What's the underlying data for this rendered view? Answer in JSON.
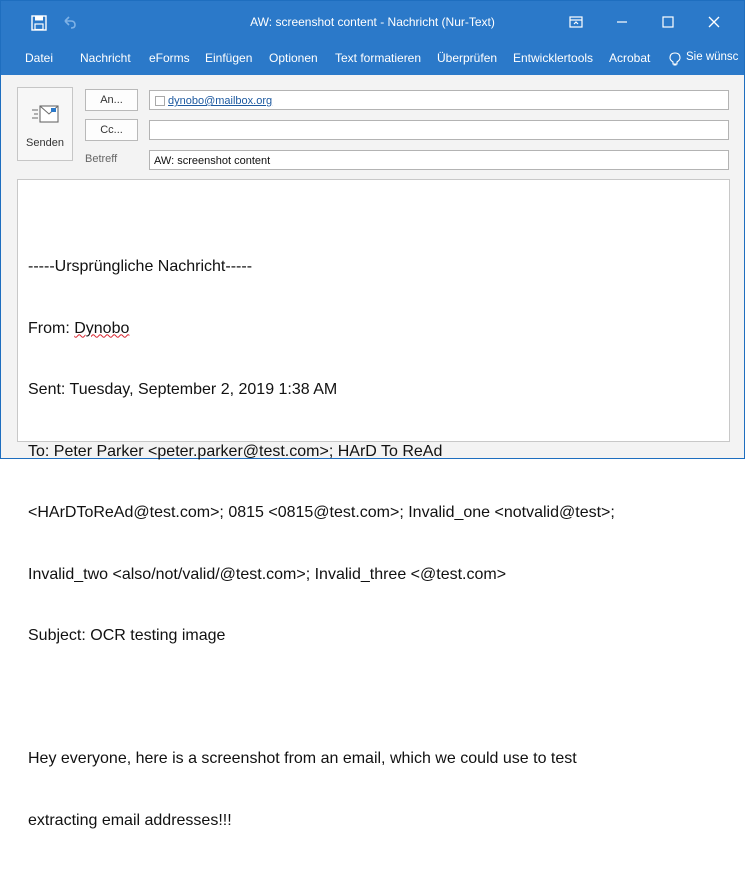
{
  "window": {
    "title": "AW: screenshot content - Nachricht (Nur-Text)"
  },
  "titlebar": {
    "icons": [
      "save-icon",
      "undo-icon",
      "ribbon-display-icon",
      "minimize-icon",
      "maximize-icon",
      "close-icon"
    ]
  },
  "ribbon": {
    "tabs": [
      "Datei",
      "Nachricht",
      "eForms",
      "Einfügen",
      "Optionen",
      "Text formatieren",
      "Überprüfen",
      "Entwicklertools",
      "Acrobat"
    ],
    "tell_me": "Sie wünsc"
  },
  "compose": {
    "send_label": "Senden",
    "to_button": "An...",
    "cc_button": "Cc...",
    "subject_label": "Betreff",
    "to_value": "dynobo@mailbox.org",
    "cc_value": "",
    "subject_value": "AW: screenshot content"
  },
  "body": {
    "lines": [
      "-----Ursprüngliche Nachricht-----",
      "From: Dynobo",
      "Sent: Tuesday, September 2, 2019 1:38 AM",
      "To: Peter Parker <peter.parker@test.com>; HArD To ReAd",
      "<HArDToReAd@test.com>; 0815 <0815@test.com>; Invalid_one <notvalid@test>;",
      "Invalid_two <also/not/valid/@test.com>; Invalid_three <@test.com>",
      "Subject: OCR testing image",
      "",
      "Hey everyone, here is a screenshot from an email, which we could use to test",
      "extracting email addresses!!!"
    ]
  },
  "colors": {
    "accent": "#2b79c9",
    "link": "#1e5aa0"
  }
}
